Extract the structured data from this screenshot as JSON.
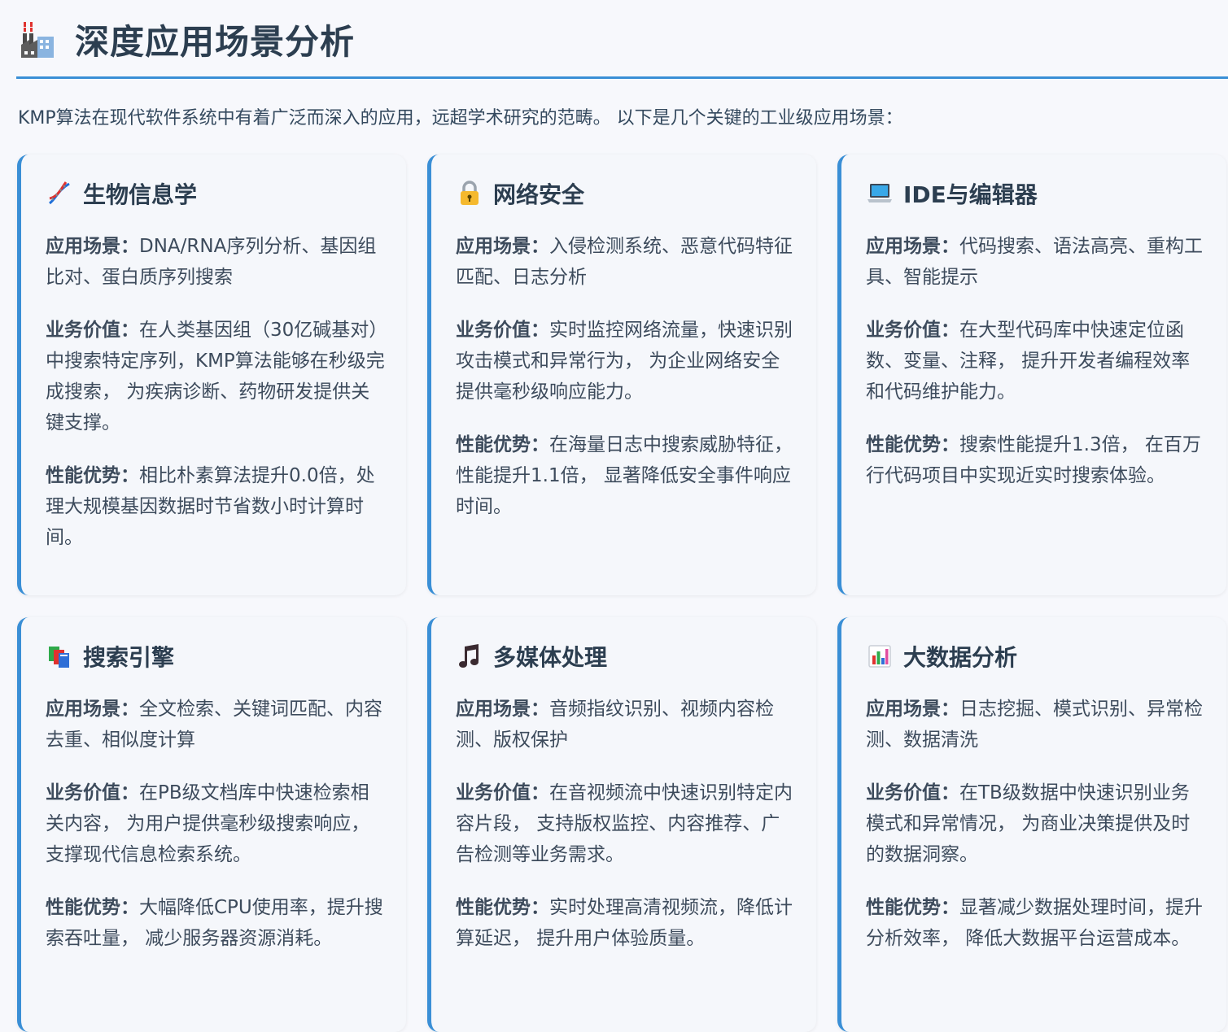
{
  "page_title": "深度应用场景分析",
  "title_icon": "factory-icon",
  "intro": "KMP算法在现代软件系统中有着广泛而深入的应用，远超学术研究的范畴。 以下是几个关键的工业级应用场景：",
  "accent_color": "#3a8fd6",
  "cards": [
    {
      "icon": "dna-icon",
      "title": "生物信息学",
      "scenario_label": "应用场景：",
      "scenario": "DNA/RNA序列分析、基因组比对、蛋白质序列搜索",
      "value_label": "业务价值：",
      "value": "在人类基因组（30亿碱基对）中搜索特定序列，KMP算法能够在秒级完成搜索， 为疾病诊断、药物研发提供关键支撑。",
      "perf_label": "性能优势：",
      "perf": "相比朴素算法提升0.0倍，处理大规模基因数据时节省数小时计算时间。"
    },
    {
      "icon": "lock-icon",
      "title": "网络安全",
      "scenario_label": "应用场景：",
      "scenario": "入侵检测系统、恶意代码特征匹配、日志分析",
      "value_label": "业务价值：",
      "value": "实时监控网络流量，快速识别攻击模式和异常行为， 为企业网络安全提供毫秒级响应能力。",
      "perf_label": "性能优势：",
      "perf": "在海量日志中搜索威胁特征，性能提升1.1倍， 显著降低安全事件响应时间。"
    },
    {
      "icon": "laptop-icon",
      "title": "IDE与编辑器",
      "scenario_label": "应用场景：",
      "scenario": "代码搜索、语法高亮、重构工具、智能提示",
      "value_label": "业务价值：",
      "value": "在大型代码库中快速定位函数、变量、注释， 提升开发者编程效率和代码维护能力。",
      "perf_label": "性能优势：",
      "perf": "搜索性能提升1.3倍， 在百万行代码项目中实现近实时搜索体验。"
    },
    {
      "icon": "books-icon",
      "title": "搜索引擎",
      "scenario_label": "应用场景：",
      "scenario": "全文检索、关键词匹配、内容去重、相似度计算",
      "value_label": "业务价值：",
      "value": "在PB级文档库中快速检索相关内容， 为用户提供毫秒级搜索响应，支撑现代信息检索系统。",
      "perf_label": "性能优势：",
      "perf": "大幅降低CPU使用率，提升搜索吞吐量， 减少服务器资源消耗。"
    },
    {
      "icon": "music-note-icon",
      "title": "多媒体处理",
      "scenario_label": "应用场景：",
      "scenario": "音频指纹识别、视频内容检测、版权保护",
      "value_label": "业务价值：",
      "value": "在音视频流中快速识别特定内容片段， 支持版权监控、内容推荐、广告检测等业务需求。",
      "perf_label": "性能优势：",
      "perf": "实时处理高清视频流，降低计算延迟， 提升用户体验质量。"
    },
    {
      "icon": "bar-chart-icon",
      "title": "大数据分析",
      "scenario_label": "应用场景：",
      "scenario": "日志挖掘、模式识别、异常检测、数据清洗",
      "value_label": "业务价值：",
      "value": "在TB级数据中快速识别业务模式和异常情况， 为商业决策提供及时的数据洞察。",
      "perf_label": "性能优势：",
      "perf": "显著减少数据处理时间，提升分析效率， 降低大数据平台运营成本。"
    }
  ]
}
